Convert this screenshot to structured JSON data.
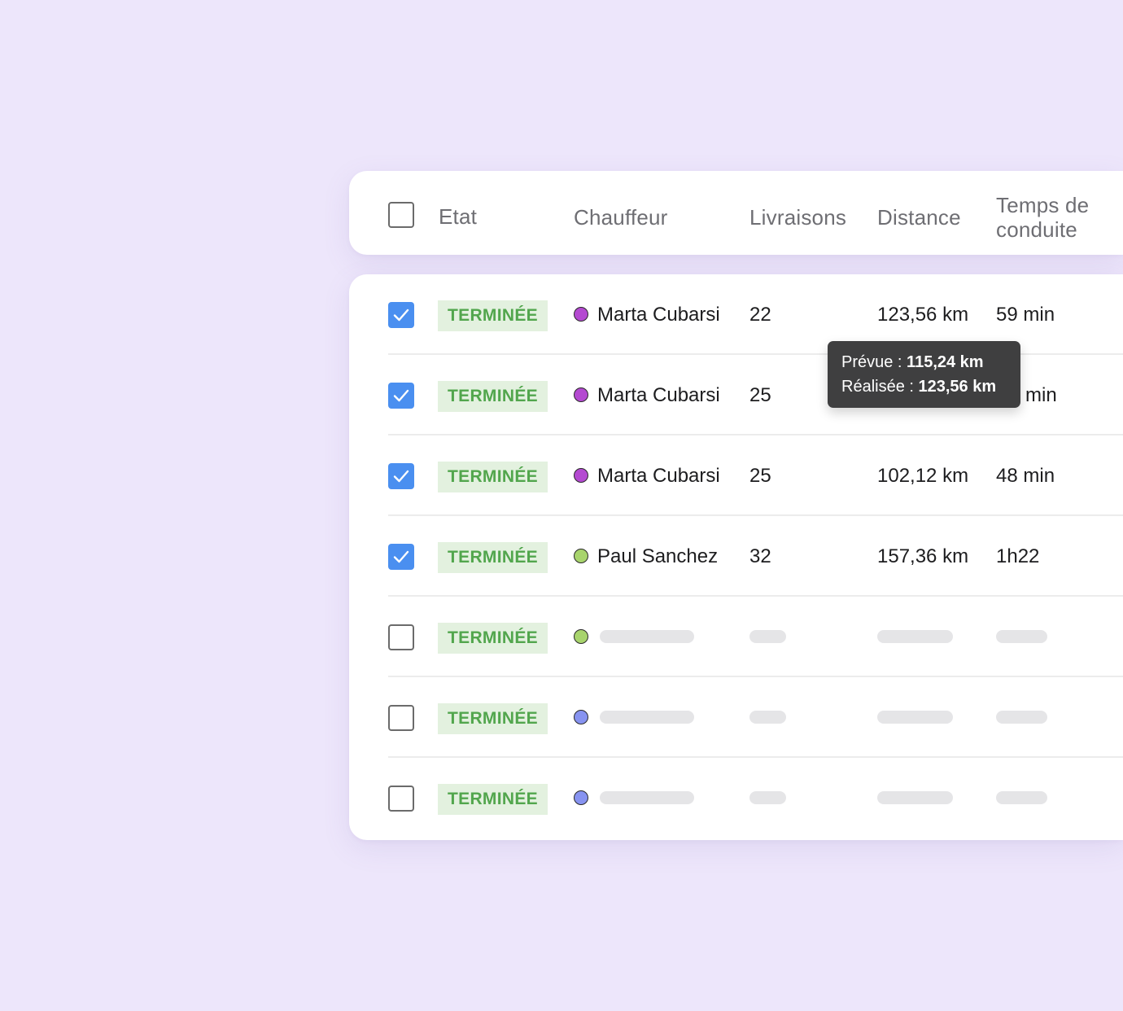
{
  "colors": {
    "background": "#ede6fb",
    "accent_checkbox": "#4a8ff0",
    "badge_bg": "#e3f1df",
    "badge_text": "#52a64d",
    "dot_purple": "#b44ad1",
    "dot_green": "#a8d46d",
    "dot_blue": "#8793f0",
    "tooltip_bg": "#3f3f40"
  },
  "table": {
    "headers": {
      "etat": "Etat",
      "chauffeur": "Chauffeur",
      "livraisons": "Livraisons",
      "distance": "Distance",
      "temps_line1": "Temps de",
      "temps_line2": "conduite"
    },
    "rows": [
      {
        "checked": true,
        "status": "TERMINÉE",
        "dot": "purple",
        "driver": "Marta Cubarsi",
        "deliveries": "22",
        "distance": "123,56 km",
        "time": "59 min"
      },
      {
        "checked": true,
        "status": "TERMINÉE",
        "dot": "purple",
        "driver": "Marta Cubarsi",
        "deliveries": "25",
        "distance": "",
        "time": "min"
      },
      {
        "checked": true,
        "status": "TERMINÉE",
        "dot": "purple",
        "driver": "Marta Cubarsi",
        "deliveries": "25",
        "distance": "102,12 km",
        "time": "48 min"
      },
      {
        "checked": true,
        "status": "TERMINÉE",
        "dot": "green",
        "driver": "Paul Sanchez",
        "deliveries": "32",
        "distance": "157,36 km",
        "time": "1h22"
      },
      {
        "checked": false,
        "status": "TERMINÉE",
        "dot": "green",
        "loading": true
      },
      {
        "checked": false,
        "status": "TERMINÉE",
        "dot": "blue",
        "loading": true
      },
      {
        "checked": false,
        "status": "TERMINÉE",
        "dot": "blue",
        "loading": true
      }
    ]
  },
  "tooltip": {
    "planned_label": "Prévue : ",
    "planned_value": "115,24 km",
    "actual_label": "Réalisée : ",
    "actual_value": "123,56 km"
  }
}
